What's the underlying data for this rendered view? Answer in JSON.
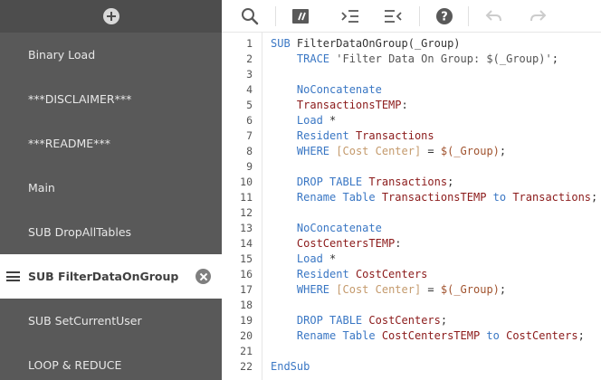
{
  "sidebar": {
    "sections": [
      {
        "label": "Binary Load",
        "active": false
      },
      {
        "label": "***DISCLAIMER***",
        "active": false
      },
      {
        "label": "***README***",
        "active": false
      },
      {
        "label": "Main",
        "active": false
      },
      {
        "label": "SUB DropAllTables",
        "active": false
      },
      {
        "label": "SUB FilterDataOnGroup",
        "active": true
      },
      {
        "label": "SUB SetCurrentUser",
        "active": false
      },
      {
        "label": "LOOP & REDUCE",
        "active": false
      }
    ],
    "add_icon": "plus-circle-icon",
    "drag_icon": "drag-handle-icon",
    "close_icon": "close-circle-icon"
  },
  "toolbar": {
    "icons": [
      "search-icon",
      "comment-toggle-icon",
      "indent-icon",
      "outdent-icon",
      "help-icon",
      "undo-icon",
      "redo-icon"
    ]
  },
  "editor": {
    "line_numbers": [
      "1",
      "2",
      "3",
      "4",
      "5",
      "6",
      "7",
      "8",
      "9",
      "10",
      "11",
      "12",
      "13",
      "14",
      "15",
      "16",
      "17",
      "18",
      "19",
      "20",
      "21",
      "22"
    ],
    "lines": [
      [
        {
          "t": "kw",
          "v": "SUB "
        },
        {
          "t": "plain",
          "v": "FilterDataOnGroup(_Group)"
        }
      ],
      [
        {
          "t": "plain",
          "v": "    "
        },
        {
          "t": "kw",
          "v": "TRACE "
        },
        {
          "t": "str",
          "v": "'Filter Data On Group: $(_Group)'"
        },
        {
          "t": "plain",
          "v": ";"
        }
      ],
      [],
      [
        {
          "t": "plain",
          "v": "    "
        },
        {
          "t": "kw",
          "v": "NoConcatenate"
        }
      ],
      [
        {
          "t": "plain",
          "v": "    "
        },
        {
          "t": "id",
          "v": "TransactionsTEMP"
        },
        {
          "t": "plain",
          "v": ":"
        }
      ],
      [
        {
          "t": "plain",
          "v": "    "
        },
        {
          "t": "kw",
          "v": "Load "
        },
        {
          "t": "plain",
          "v": "*"
        }
      ],
      [
        {
          "t": "plain",
          "v": "    "
        },
        {
          "t": "kw",
          "v": "Resident "
        },
        {
          "t": "id",
          "v": "Transactions"
        }
      ],
      [
        {
          "t": "plain",
          "v": "    "
        },
        {
          "t": "kw",
          "v": "WHERE "
        },
        {
          "t": "field",
          "v": "[Cost Center]"
        },
        {
          "t": "plain",
          "v": " = "
        },
        {
          "t": "var",
          "v": "$(_Group)"
        },
        {
          "t": "plain",
          "v": ";"
        }
      ],
      [],
      [
        {
          "t": "plain",
          "v": "    "
        },
        {
          "t": "kw",
          "v": "DROP TABLE "
        },
        {
          "t": "id",
          "v": "Transactions"
        },
        {
          "t": "plain",
          "v": ";"
        }
      ],
      [
        {
          "t": "plain",
          "v": "    "
        },
        {
          "t": "kw",
          "v": "Rename Table "
        },
        {
          "t": "id",
          "v": "TransactionsTEMP"
        },
        {
          "t": "kw",
          "v": " to "
        },
        {
          "t": "id",
          "v": "Transactions"
        },
        {
          "t": "plain",
          "v": ";"
        }
      ],
      [],
      [
        {
          "t": "plain",
          "v": "    "
        },
        {
          "t": "kw",
          "v": "NoConcatenate"
        }
      ],
      [
        {
          "t": "plain",
          "v": "    "
        },
        {
          "t": "id",
          "v": "CostCentersTEMP"
        },
        {
          "t": "plain",
          "v": ":"
        }
      ],
      [
        {
          "t": "plain",
          "v": "    "
        },
        {
          "t": "kw",
          "v": "Load "
        },
        {
          "t": "plain",
          "v": "*"
        }
      ],
      [
        {
          "t": "plain",
          "v": "    "
        },
        {
          "t": "kw",
          "v": "Resident "
        },
        {
          "t": "id",
          "v": "CostCenters"
        }
      ],
      [
        {
          "t": "plain",
          "v": "    "
        },
        {
          "t": "kw",
          "v": "WHERE "
        },
        {
          "t": "field",
          "v": "[Cost Center]"
        },
        {
          "t": "plain",
          "v": " = "
        },
        {
          "t": "var",
          "v": "$(_Group)"
        },
        {
          "t": "plain",
          "v": ";"
        }
      ],
      [],
      [
        {
          "t": "plain",
          "v": "    "
        },
        {
          "t": "kw",
          "v": "DROP TABLE "
        },
        {
          "t": "id",
          "v": "CostCenters"
        },
        {
          "t": "plain",
          "v": ";"
        }
      ],
      [
        {
          "t": "plain",
          "v": "    "
        },
        {
          "t": "kw",
          "v": "Rename Table "
        },
        {
          "t": "id",
          "v": "CostCentersTEMP"
        },
        {
          "t": "kw",
          "v": " to "
        },
        {
          "t": "id",
          "v": "CostCenters"
        },
        {
          "t": "plain",
          "v": ";"
        }
      ],
      [],
      [
        {
          "t": "kw",
          "v": "EndSub"
        }
      ]
    ]
  },
  "colors": {
    "sidebar_bg": "#595959",
    "keyword": "#3a77c4",
    "identifier": "#8b1a1a",
    "field": "#c49a6c",
    "variable": "#a0522d"
  }
}
